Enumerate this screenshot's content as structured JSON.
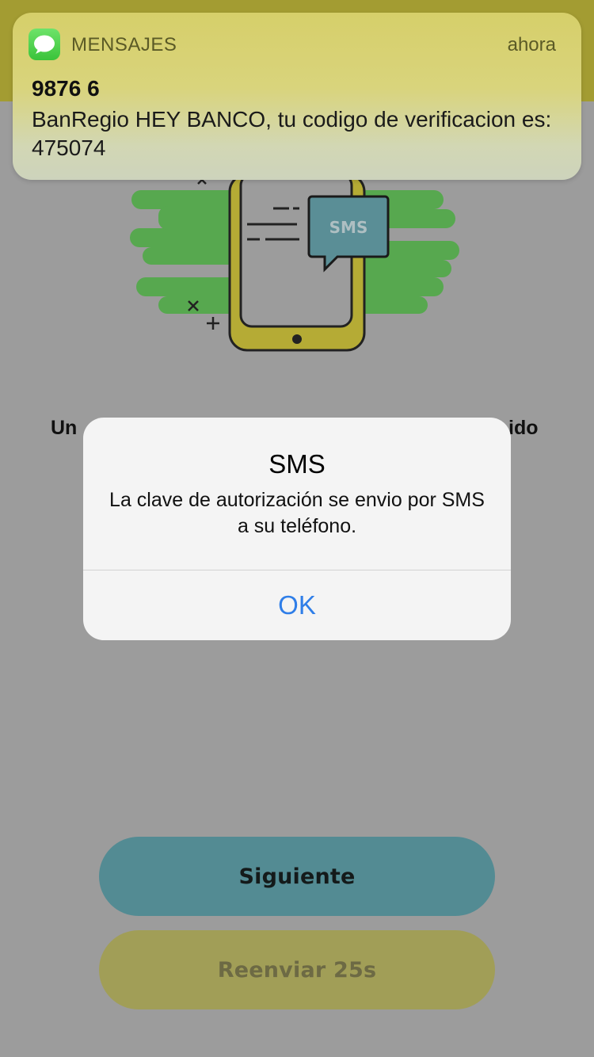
{
  "notification": {
    "app_name": "MENSAJES",
    "time": "ahora",
    "sender": "9876 6",
    "message": "BanRegio HEY BANCO, tu codigo de verificacion es: 475074",
    "icon": "messages-icon"
  },
  "illustration": {
    "badge": "SMS",
    "icon": "phone-sms-illustration"
  },
  "background": {
    "instruction_left": "Un",
    "instruction_right": "ido"
  },
  "alert": {
    "title": "SMS",
    "message": "La clave de autorización se envio por SMS a su teléfono.",
    "ok_label": "OK"
  },
  "buttons": {
    "next_label": "Siguiente",
    "resend_label": "Reenviar 25s"
  },
  "colors": {
    "accent_blue": "#2f7ee8",
    "next_button": "#538b93",
    "resend_button": "#a19e57",
    "brand_yellow": "#a39c32",
    "green": "#57a84f"
  }
}
